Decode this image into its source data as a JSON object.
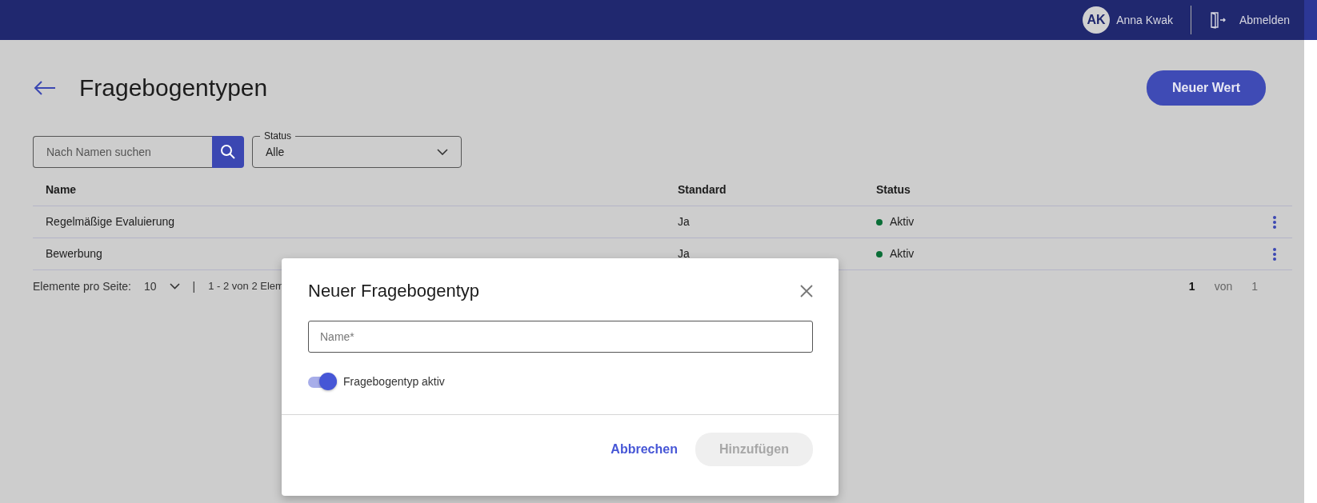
{
  "header": {
    "user": {
      "initials": "AK",
      "name": "Anna Kwak"
    },
    "logout": {
      "label": "Abmelden"
    }
  },
  "page": {
    "title": "Fragebogentypen",
    "new_button": "Neuer Wert"
  },
  "search": {
    "placeholder": "Nach Namen suchen"
  },
  "status_filter": {
    "label": "Status",
    "value": "Alle"
  },
  "table": {
    "columns": [
      "Name",
      "Standard",
      "Status"
    ],
    "rows": [
      {
        "name": "Regelmäßige Evaluierung",
        "standard": "Ja",
        "status": "Aktiv",
        "color": "#0a6e37"
      },
      {
        "name": "Bewerbung",
        "standard": "Ja",
        "status": "Aktiv",
        "color": "#0a6e37"
      }
    ]
  },
  "pagination": {
    "per_page_label": "Elemente pro Seite:",
    "per_page_value": "10",
    "separator": "|",
    "range": "1 - 2 von 2 Elem",
    "current_page": "1",
    "of": "von",
    "total_pages": "1"
  },
  "dialog": {
    "title": "Neuer Fragebogentyp",
    "name_field": {
      "placeholder": "Name*"
    },
    "toggle": {
      "label": "Fragebogentyp aktiv",
      "on": true
    },
    "cancel": "Abbrechen",
    "submit": {
      "label": "Hinzufügen",
      "disabled": true
    }
  }
}
